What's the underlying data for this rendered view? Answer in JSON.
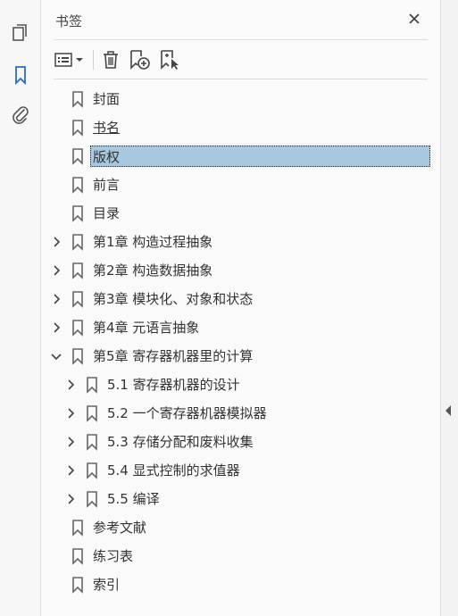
{
  "panel": {
    "title": "书签"
  },
  "tree": [
    {
      "label": "封面",
      "level": 0,
      "expandable": false,
      "selected": false
    },
    {
      "label": "书名",
      "level": 0,
      "expandable": false,
      "selected": false,
      "underline": true
    },
    {
      "label": "版权",
      "level": 0,
      "expandable": false,
      "selected": true
    },
    {
      "label": "前言",
      "level": 0,
      "expandable": false,
      "selected": false
    },
    {
      "label": "目录",
      "level": 0,
      "expandable": false,
      "selected": false
    },
    {
      "label": "第1章 构造过程抽象",
      "level": 0,
      "expandable": true,
      "expanded": false
    },
    {
      "label": "第2章 构造数据抽象",
      "level": 0,
      "expandable": true,
      "expanded": false
    },
    {
      "label": "第3章 模块化、对象和状态",
      "level": 0,
      "expandable": true,
      "expanded": false
    },
    {
      "label": "第4章 元语言抽象",
      "level": 0,
      "expandable": true,
      "expanded": false
    },
    {
      "label": "第5章 寄存器机器里的计算",
      "level": 0,
      "expandable": true,
      "expanded": true
    },
    {
      "label": "5.1 寄存器机器的设计",
      "level": 1,
      "expandable": true,
      "expanded": false
    },
    {
      "label": "5.2 一个寄存器机器模拟器",
      "level": 1,
      "expandable": true,
      "expanded": false
    },
    {
      "label": "5.3 存储分配和废料收集",
      "level": 1,
      "expandable": true,
      "expanded": false
    },
    {
      "label": "5.4 显式控制的求值器",
      "level": 1,
      "expandable": true,
      "expanded": false
    },
    {
      "label": "5.5 编译",
      "level": 1,
      "expandable": true,
      "expanded": false
    },
    {
      "label": "参考文献",
      "level": 0,
      "expandable": false
    },
    {
      "label": "练习表",
      "level": 0,
      "expandable": false
    },
    {
      "label": "索引",
      "level": 0,
      "expandable": false
    }
  ],
  "colors": {
    "accent": "#2a6ebb",
    "selection": "#a7c8de",
    "icon": "#555555"
  }
}
